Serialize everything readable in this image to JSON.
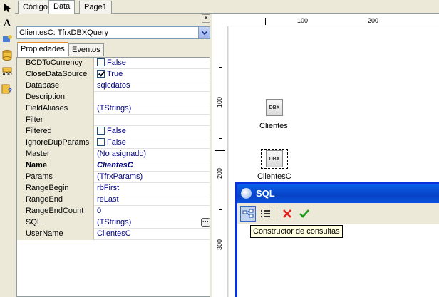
{
  "designer_tabs": [
    "Código",
    "Data",
    "Page1"
  ],
  "inspector": {
    "close_glyph": "×",
    "object_combo": "ClientesC: TfrxDBXQuery",
    "tabs": [
      "Propiedades",
      "Eventos"
    ],
    "properties": [
      {
        "name": "BCDToCurrency",
        "value": "False",
        "check": false
      },
      {
        "name": "CloseDataSource",
        "value": "True",
        "check": true
      },
      {
        "name": "Database",
        "value": "sqlcdatos"
      },
      {
        "name": "Description",
        "value": ""
      },
      {
        "name": "FieldAliases",
        "value": "(TStrings)"
      },
      {
        "name": "Filter",
        "value": ""
      },
      {
        "name": "Filtered",
        "value": "False",
        "check": false
      },
      {
        "name": "IgnoreDupParams",
        "value": "False",
        "check": false
      },
      {
        "name": "Master",
        "value": "(No asignado)"
      },
      {
        "name": "Name",
        "value": "ClientesC",
        "bold": true
      },
      {
        "name": "Params",
        "value": "(TfrxParams)"
      },
      {
        "name": "RangeBegin",
        "value": "rbFirst"
      },
      {
        "name": "RangeEnd",
        "value": "reLast"
      },
      {
        "name": "RangeEndCount",
        "value": "0"
      },
      {
        "name": "SQL",
        "value": "(TStrings)",
        "ellipsis": true,
        "selected": true
      },
      {
        "name": "UserName",
        "value": "ClientesC"
      }
    ]
  },
  "ruler": {
    "h_labels": [
      "100",
      "200"
    ],
    "v_labels": [
      "100",
      "200",
      "300"
    ]
  },
  "components": [
    {
      "label": "Clientes",
      "icon": "DBX"
    },
    {
      "label": "ClientesC",
      "icon": "DBX"
    }
  ],
  "sql_window": {
    "title": "SQL",
    "tooltip": "Constructor de consultas"
  },
  "colors": {
    "title_bar": "#0a54df",
    "cancel_red": "#e02020",
    "ok_green": "#1a9a1a"
  }
}
